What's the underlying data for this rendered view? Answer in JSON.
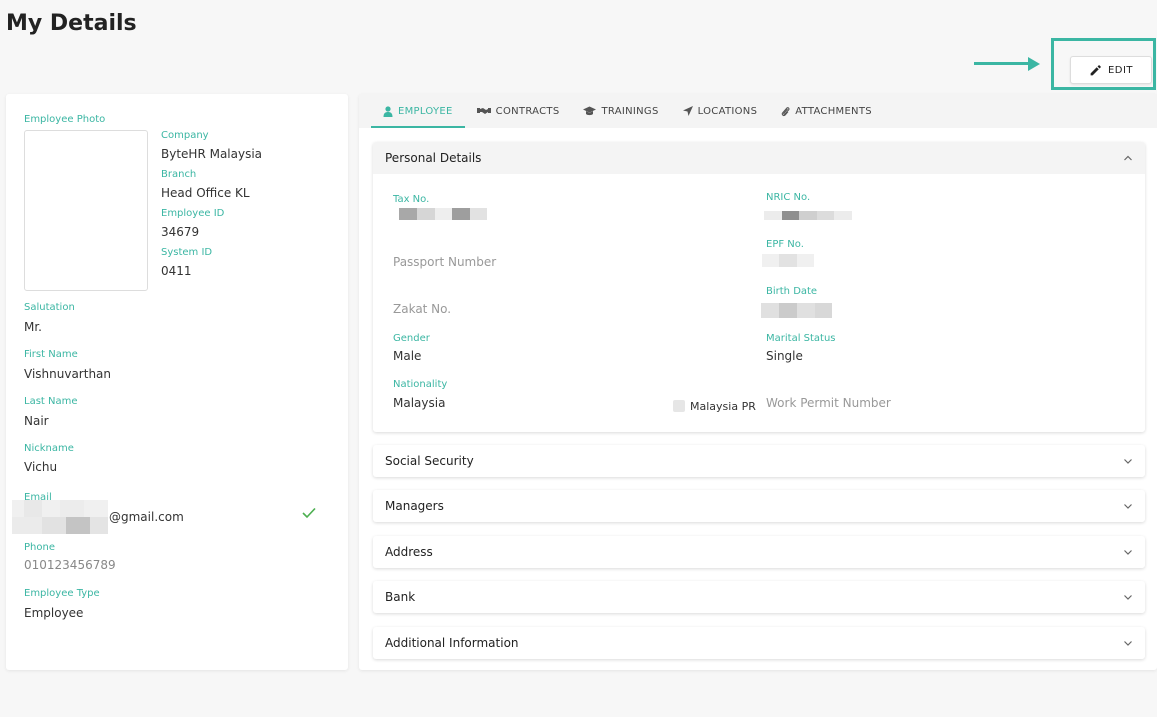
{
  "page": {
    "title": "My Details"
  },
  "toolbar": {
    "edit_label": "EDIT"
  },
  "colors": {
    "accent": "#3bb6a3"
  },
  "left_card": {
    "photo_label": "Employee Photo",
    "company_label": "Company",
    "company": "ByteHR Malaysia",
    "branch_label": "Branch",
    "branch": "Head Office KL",
    "employee_id_label": "Employee ID",
    "employee_id": "34679",
    "system_id_label": "System ID",
    "system_id": "0411",
    "salutation_label": "Salutation",
    "salutation": "Mr.",
    "first_name_label": "First Name",
    "first_name": "Vishnuvarthan",
    "last_name_label": "Last Name",
    "last_name": "Nair",
    "nickname_label": "Nickname",
    "nickname": "Vichu",
    "email_label": "Email",
    "email_suffix": "@gmail.com",
    "phone_label": "Phone",
    "phone": "010123456789",
    "employee_type_label": "Employee Type",
    "employee_type": "Employee"
  },
  "tabs": [
    {
      "label": "EMPLOYEE",
      "icon": "person-icon",
      "active": true
    },
    {
      "label": "CONTRACTS",
      "icon": "handshake-icon",
      "active": false
    },
    {
      "label": "TRAININGS",
      "icon": "graduation-cap-icon",
      "active": false
    },
    {
      "label": "LOCATIONS",
      "icon": "location-arrow-icon",
      "active": false
    },
    {
      "label": "ATTACHMENTS",
      "icon": "paperclip-icon",
      "active": false
    }
  ],
  "personal_details": {
    "title": "Personal Details",
    "tax_label": "Tax No.",
    "nric_label": "NRIC No.",
    "passport_placeholder": "Passport Number",
    "epf_label": "EPF No.",
    "zakat_placeholder": "Zakat No.",
    "birth_label": "Birth Date",
    "gender_label": "Gender",
    "gender": "Male",
    "marital_label": "Marital Status",
    "marital": "Single",
    "nationality_label": "Nationality",
    "nationality": "Malaysia",
    "malaysia_pr_label": "Malaysia PR",
    "work_permit_placeholder": "Work Permit Number"
  },
  "sections": [
    {
      "title": "Social Security"
    },
    {
      "title": "Managers"
    },
    {
      "title": "Address"
    },
    {
      "title": "Bank"
    },
    {
      "title": "Additional Information"
    }
  ]
}
